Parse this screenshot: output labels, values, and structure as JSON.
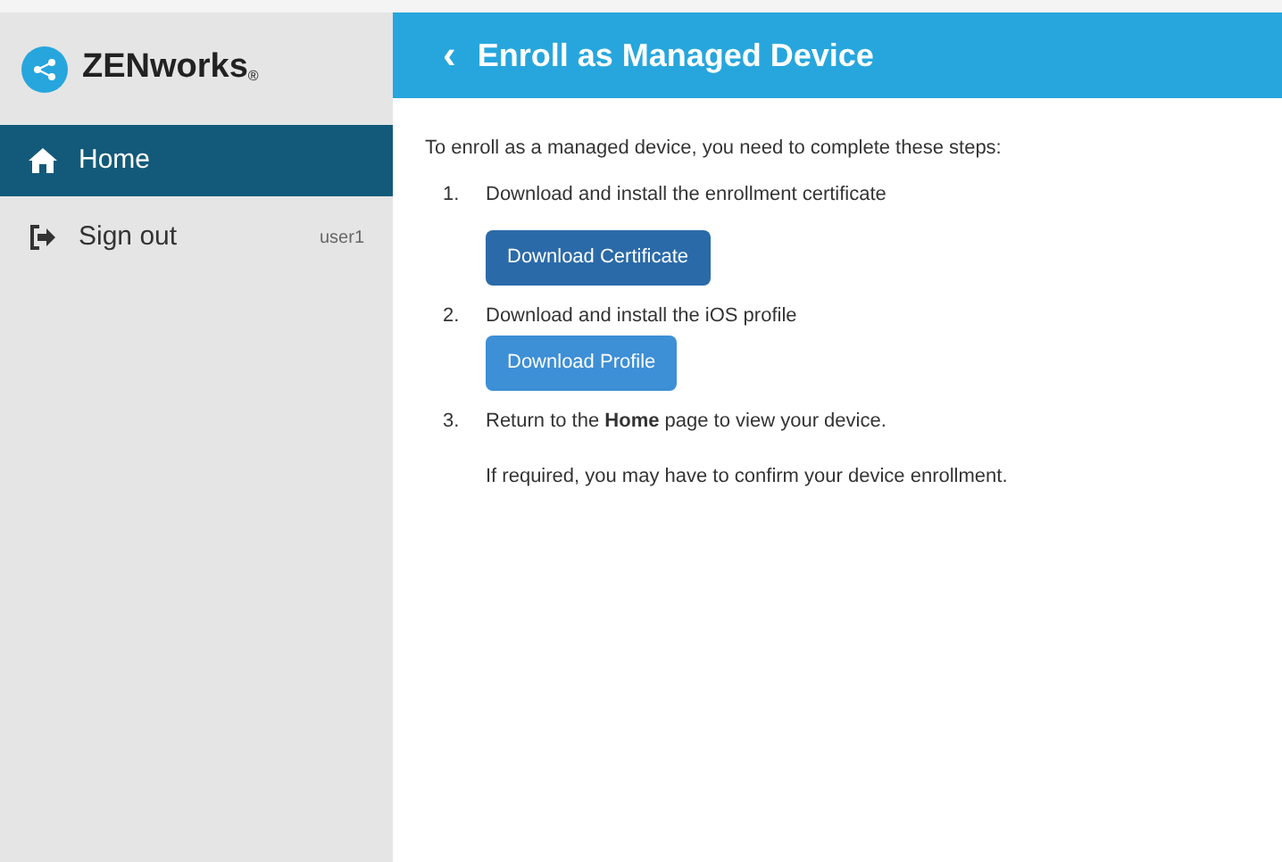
{
  "sidebar": {
    "logo": {
      "title": "ZENworks",
      "mark": "®"
    },
    "items": [
      {
        "kind": "home",
        "label": "Home",
        "selected": true
      },
      {
        "kind": "signout",
        "label": "Sign out",
        "badge": "user1",
        "selected": false
      }
    ]
  },
  "header": {
    "back": "‹",
    "title": "Enroll as Managed Device"
  },
  "content": {
    "intro": "To enroll as a managed device, you need to complete these steps:",
    "steps": [
      {
        "number": "1.",
        "text": "Download and install the enrollment certificate",
        "button": {
          "label": "Download Certificate",
          "focused": true
        }
      },
      {
        "number": "2.",
        "text": "Download and install the iOS profile",
        "button": {
          "label": "Download Profile",
          "focused": false
        }
      },
      {
        "number": "3.",
        "text": "Return to the **Home** page to view your device.",
        "note": "If required, you may have to confirm your device enrollment."
      }
    ]
  }
}
